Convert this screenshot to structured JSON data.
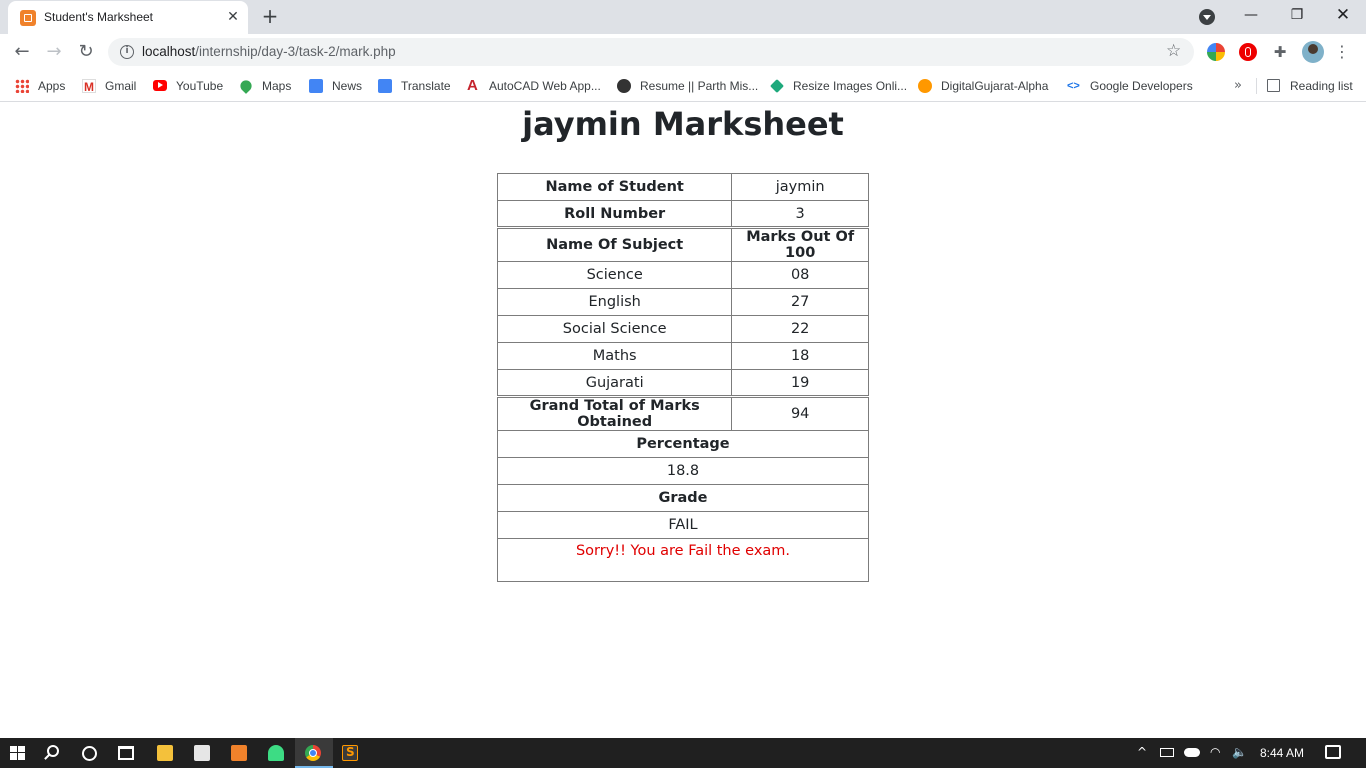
{
  "browser": {
    "tab_title": "Student's Marksheet",
    "tab_close": "✕",
    "new_tab": "+",
    "window_controls": {
      "minimize": "—",
      "maximize": "❐",
      "close": "✕"
    },
    "url_host": "localhost",
    "url_path": "/internship/day-3/task-2/mark.php",
    "nav": {
      "back": "←",
      "forward": "→",
      "reload": "↻"
    },
    "star": "☆",
    "menu": "⋮",
    "extensions_icon": "✚"
  },
  "bookmarks": {
    "items": [
      {
        "label": "Apps",
        "icon": "apps-grid-icon"
      },
      {
        "label": "Gmail",
        "icon": "gmail-icon"
      },
      {
        "label": "YouTube",
        "icon": "youtube-icon"
      },
      {
        "label": "Maps",
        "icon": "maps-icon"
      },
      {
        "label": "News",
        "icon": "news-icon"
      },
      {
        "label": "Translate",
        "icon": "translate-icon"
      },
      {
        "label": "AutoCAD Web App...",
        "icon": "autocad-icon"
      },
      {
        "label": "Resume || Parth Mis...",
        "icon": "resume-icon"
      },
      {
        "label": "Resize Images Onli...",
        "icon": "resize-icon"
      },
      {
        "label": "DigitalGujarat-Alpha",
        "icon": "digitalgujarat-icon"
      },
      {
        "label": "Google Developers",
        "icon": "google-developers-icon"
      }
    ],
    "more": "»",
    "reading_list": "Reading list"
  },
  "page": {
    "title": "jaymin Marksheet",
    "rows": {
      "name_label": "Name of Student",
      "name_value": "jaymin",
      "roll_label": "Roll Number",
      "roll_value": "3",
      "subject_header": "Name Of Subject",
      "marks_header": "Marks Out Of 100"
    },
    "subjects": [
      {
        "name": "Science",
        "marks": "08"
      },
      {
        "name": "English",
        "marks": "27"
      },
      {
        "name": "Social Science",
        "marks": "22"
      },
      {
        "name": "Maths",
        "marks": "18"
      },
      {
        "name": "Gujarati",
        "marks": "19"
      }
    ],
    "total_label": "Grand Total of Marks Obtained",
    "total_value": "94",
    "percentage_label": "Percentage",
    "percentage_value": "18.8",
    "grade_label": "Grade",
    "grade_value": "FAIL",
    "message": "Sorry!! You are Fail the exam.",
    "message_color": "#e00000"
  },
  "taskbar": {
    "apps": [
      "start-icon",
      "search-icon",
      "cortana-icon",
      "task-view-icon",
      "file-explorer-icon",
      "store-icon",
      "xampp-icon",
      "android-studio-icon",
      "chrome-icon",
      "sublime-text-icon"
    ],
    "tray_chevron": "^",
    "wifi": "◠",
    "volume": "🔈",
    "clock": "8:44 AM"
  }
}
